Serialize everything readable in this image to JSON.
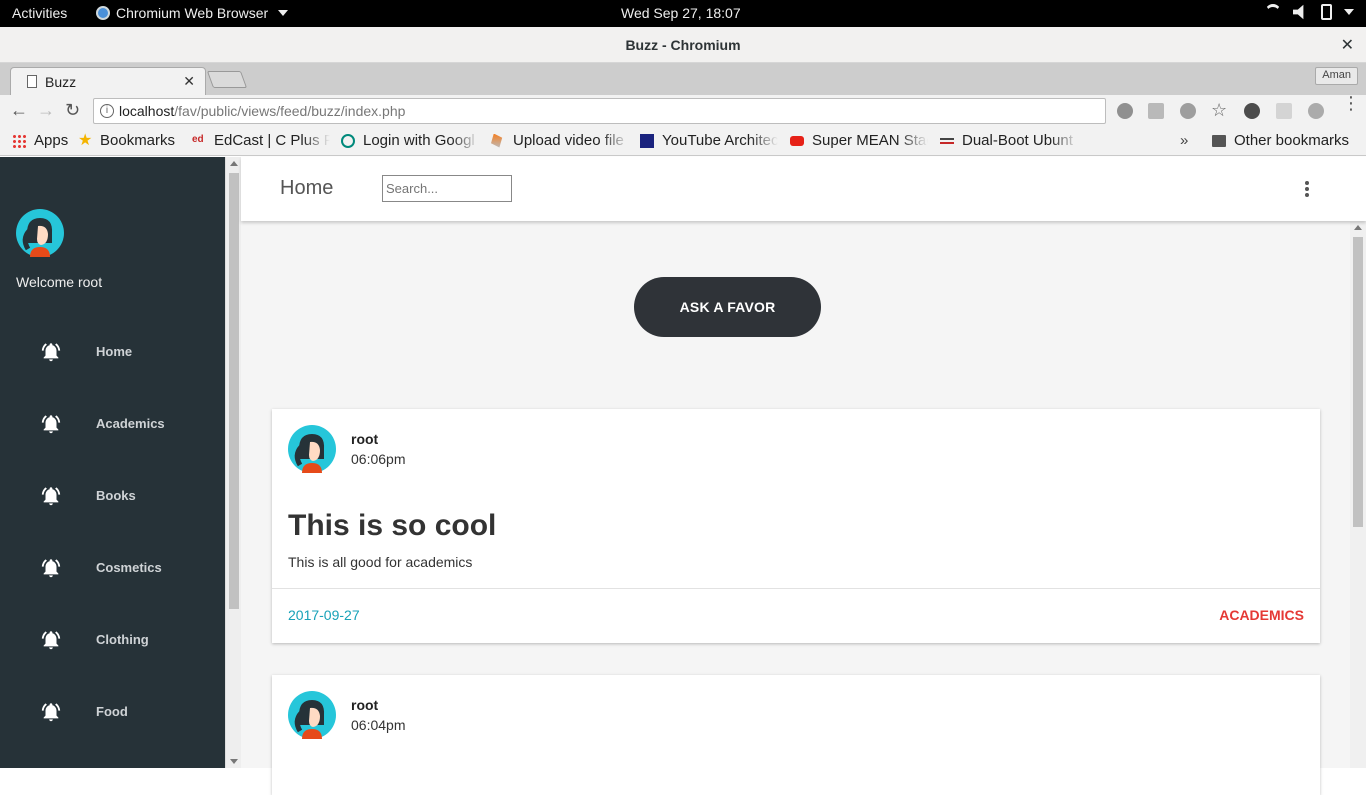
{
  "system": {
    "activities": "Activities",
    "app_name": "Chromium Web Browser",
    "clock": "Wed Sep 27, 18:07"
  },
  "window": {
    "title": "Buzz - Chromium",
    "close": "✕"
  },
  "tabs": [
    {
      "title": "Buzz",
      "close": "✕"
    }
  ],
  "profile": "Aman",
  "address": {
    "host": "localhost",
    "path": "/fav/public/views/feed/buzz/index.php"
  },
  "bookmarks": {
    "apps": "Apps",
    "items": [
      {
        "label": "Bookmarks",
        "icon": "star-icon"
      },
      {
        "label": "EdCast | C Plus P",
        "icon": "edcast-icon"
      },
      {
        "label": "Login with Googl",
        "icon": "login-icon"
      },
      {
        "label": "Upload video file",
        "icon": "stackoverflow-icon"
      },
      {
        "label": "YouTube Architec",
        "icon": "youtube-architecture-icon"
      },
      {
        "label": "Super MEAN Stac",
        "icon": "youtube-icon"
      },
      {
        "label": "Dual-Boot Ubunt",
        "icon": "dualboot-icon"
      }
    ],
    "overflow": "»",
    "other": "Other bookmarks"
  },
  "sidebar": {
    "welcome": "Welcome root",
    "items": [
      {
        "label": "Home"
      },
      {
        "label": "Academics"
      },
      {
        "label": "Books"
      },
      {
        "label": "Cosmetics"
      },
      {
        "label": "Clothing"
      },
      {
        "label": "Food"
      }
    ]
  },
  "header": {
    "home": "Home",
    "search_placeholder": "Search..."
  },
  "ask_button": "ASK A FAVOR",
  "posts": [
    {
      "user": "root",
      "time": "06:06pm",
      "title": "This is so cool",
      "body": "This is all good for academics",
      "date": "2017-09-27",
      "category": "ACADEMICS"
    },
    {
      "user": "root",
      "time": "06:04pm"
    }
  ],
  "colors": {
    "sidebar_bg": "#263238",
    "ask_button_bg": "#2f3338",
    "date_color": "#17a2b8",
    "category_color": "#e53935"
  }
}
